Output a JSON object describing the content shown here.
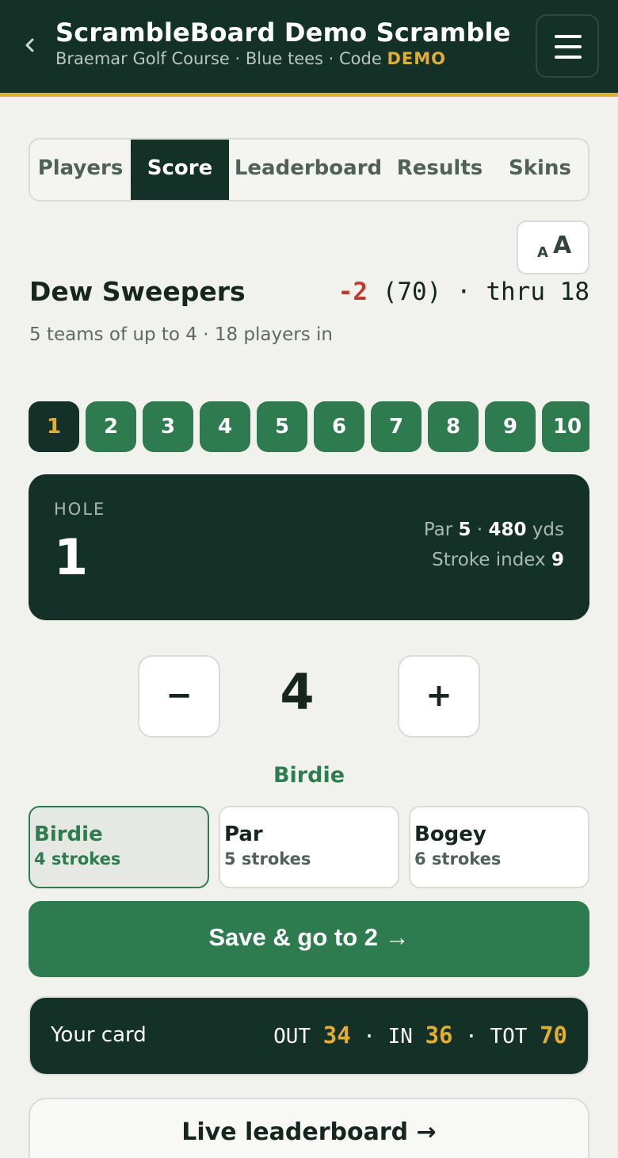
{
  "header": {
    "title": "ScrambleBoard Demo Scramble",
    "course": "Braemar Golf Course · Blue tees · Code ",
    "code": "DEMO",
    "back_icon": "chevron-left-icon",
    "menu_icon": "hamburger-menu-icon"
  },
  "tabs": [
    {
      "label": "Players"
    },
    {
      "label": "Score"
    },
    {
      "label": "Leaderboard"
    },
    {
      "label": "Results"
    },
    {
      "label": "Skins"
    }
  ],
  "active_tab": "Score",
  "font_toggle": {
    "small": "A",
    "big": "A"
  },
  "team": {
    "name": "Dew Sweepers",
    "to_par": "-2",
    "score_rest": " (70) · thru 18",
    "meta": "5 teams of up to 4 · 18 players in"
  },
  "holes": [
    "1",
    "2",
    "3",
    "4",
    "5",
    "6",
    "7",
    "8",
    "9",
    "10"
  ],
  "active_hole": "1",
  "hole_card": {
    "label": "HOLE",
    "number": "1",
    "par_label": "Par ",
    "par": "5",
    "sep": " · ",
    "yards": "480",
    "yards_unit": " yds",
    "si_label": "Stroke index ",
    "si": "9"
  },
  "stepper": {
    "minus": "−",
    "value": "4",
    "plus": "+"
  },
  "result_label": "Birdie",
  "picks": [
    {
      "name": "Birdie",
      "strokes": "4 strokes",
      "selected": true
    },
    {
      "name": "Par",
      "strokes": "5 strokes",
      "selected": false
    },
    {
      "name": "Bogey",
      "strokes": "6 strokes",
      "selected": false
    }
  ],
  "save_button": "Save & go to 2 →",
  "card": {
    "label": "Your card",
    "out_label": "OUT ",
    "out": "34",
    "in_label": " · IN ",
    "in": "36",
    "tot_label": " · TOT ",
    "tot": "70"
  },
  "live_button": "Live leaderboard →",
  "colors": {
    "dark_green": "#143128",
    "accent_green": "#2e7b50",
    "gold": "#e3ad32",
    "negative_red": "#c0392b",
    "background": "#f1f2ee"
  }
}
